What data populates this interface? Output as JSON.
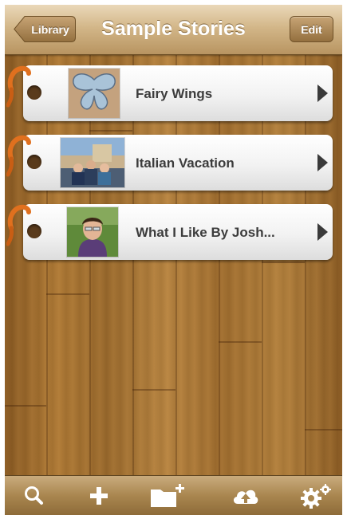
{
  "navbar": {
    "title": "Sample Stories",
    "back_label": "Library",
    "edit_label": "Edit"
  },
  "stories": [
    {
      "title": "Fairy Wings",
      "thumbnail_icon": "butterfly-wings-thumbnail"
    },
    {
      "title": "Italian Vacation",
      "thumbnail_icon": "family-photo-thumbnail"
    },
    {
      "title": "What I Like By Josh...",
      "thumbnail_icon": "boy-portrait-thumbnail"
    }
  ],
  "toolbar": {
    "buttons": [
      "search-icon",
      "add-icon",
      "new-folder-icon",
      "cloud-upload-icon",
      "settings-gears-icon"
    ]
  },
  "colors": {
    "navbar": "#d3b789",
    "wood": "#a8763a",
    "hook": "#e0701e",
    "row": "#f2f2f2",
    "label": "#3c3c3c"
  }
}
